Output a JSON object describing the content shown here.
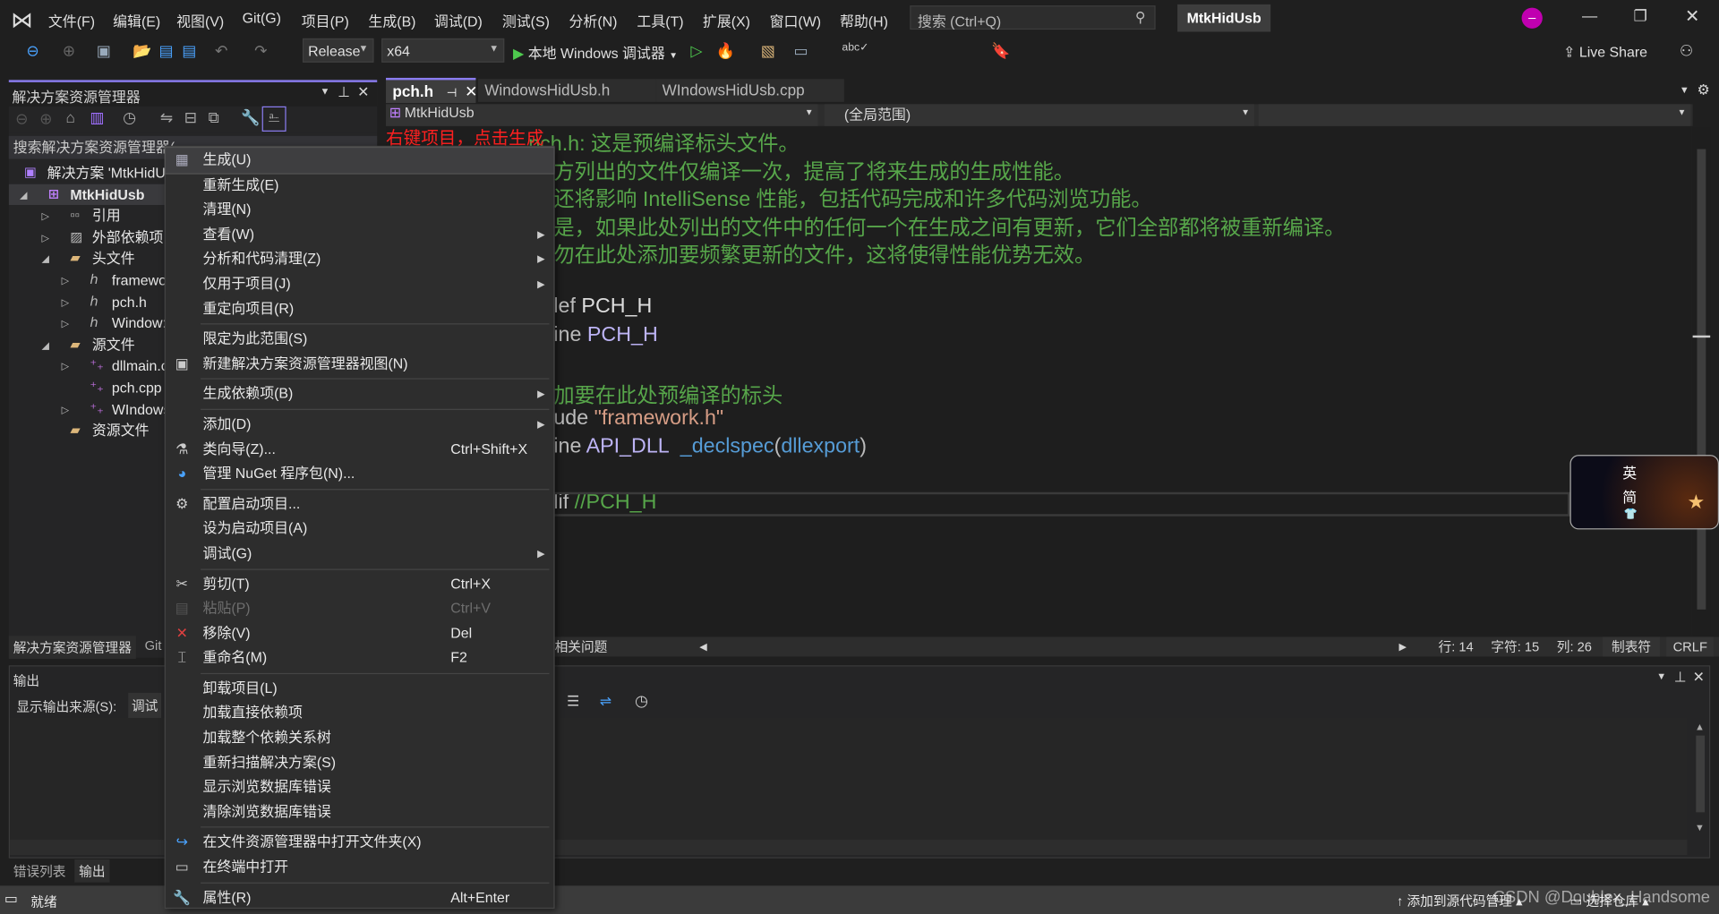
{
  "menu": [
    "文件(F)",
    "编辑(E)",
    "视图(V)",
    "Git(G)",
    "项目(P)",
    "生成(B)",
    "调试(D)",
    "测试(S)",
    "分析(N)",
    "工具(T)",
    "扩展(X)",
    "窗口(W)",
    "帮助(H)"
  ],
  "search_placeholder": "搜索 (Ctrl+Q)",
  "window_title": "MtkHidUsb",
  "toolbar": {
    "configuration": "Release",
    "platform": "x64",
    "debugger": "本地 Windows 调试器",
    "live_share": "Live Share"
  },
  "solution_explorer": {
    "title": "解决方案资源管理器",
    "search_placeholder": "搜索解决方案资源管理器(",
    "tree": [
      {
        "label": "解决方案 'MtkHidU",
        "level": 0,
        "icon": "solution-icon",
        "expander": "none"
      },
      {
        "label": "MtkHidUsb",
        "level": 1,
        "icon": "project-icon",
        "expander": "expanded",
        "selected": true
      },
      {
        "label": "引用",
        "level": 2,
        "icon": "references-icon",
        "expander": "collapsed"
      },
      {
        "label": "外部依赖项",
        "level": 2,
        "icon": "external-deps-icon",
        "expander": "collapsed"
      },
      {
        "label": "头文件",
        "level": 2,
        "icon": "filter-folder-icon",
        "expander": "expanded"
      },
      {
        "label": "framewo",
        "level": 3,
        "icon": "header-file-icon",
        "expander": "collapsed"
      },
      {
        "label": "pch.h",
        "level": 3,
        "icon": "header-file-icon",
        "expander": "collapsed"
      },
      {
        "label": "Window:",
        "level": 3,
        "icon": "header-file-icon",
        "expander": "collapsed"
      },
      {
        "label": "源文件",
        "level": 2,
        "icon": "filter-folder-icon",
        "expander": "expanded"
      },
      {
        "label": "dllmain.c",
        "level": 3,
        "icon": "cpp-file-icon",
        "expander": "collapsed"
      },
      {
        "label": "pch.cpp",
        "level": 3,
        "icon": "cpp-file-icon",
        "expander": "none"
      },
      {
        "label": "WIndows",
        "level": 3,
        "icon": "cpp-file-icon",
        "expander": "collapsed"
      },
      {
        "label": "资源文件",
        "level": 2,
        "icon": "filter-folder-icon",
        "expander": "none"
      }
    ],
    "bottom_tabs": [
      "解决方案资源管理器",
      "Git"
    ]
  },
  "annotation": "右键项目，点击生成",
  "editor": {
    "tabs": [
      {
        "label": "pch.h",
        "active": true
      },
      {
        "label": "WindowsHidUsb.h"
      },
      {
        "label": "WIndowsHidUsb.cpp"
      }
    ],
    "nav_project": "MtkHidUsb",
    "nav_scope": "(全局范围)",
    "lines": [
      {
        "parts": [
          {
            "t": "pch.h: 这是预编译标头文件。",
            "c": "cm"
          }
        ]
      },
      {
        "parts": [
          {
            "t": "方列出的文件仅编译一次，提高了将来生成的生成性能。",
            "c": "cm"
          }
        ]
      },
      {
        "parts": [
          {
            "t": "还将影响 IntelliSense 性能，包括代码完成和许多代码浏览功能。",
            "c": "cm"
          }
        ]
      },
      {
        "parts": [
          {
            "t": "是，如果此处列出的文件中的任何一个在生成之间有更新，它们全部都将被重新编译。",
            "c": "cm"
          }
        ]
      },
      {
        "parts": [
          {
            "t": "勿在此处添加要频繁更新的文件，这将使得性能优势无效。",
            "c": "cm"
          }
        ]
      },
      {
        "parts": []
      },
      {
        "parts": [
          {
            "t": "lef ",
            "c": "kw"
          },
          {
            "t": "PCH_H",
            "c": "kw2"
          }
        ]
      },
      {
        "parts": [
          {
            "t": "ine ",
            "c": "kw"
          },
          {
            "t": "PCH_H",
            "c": "mac"
          }
        ]
      },
      {
        "parts": []
      },
      {
        "parts": [
          {
            "t": "加要在此处预编译的标头",
            "c": "cm"
          }
        ]
      },
      {
        "parts": [
          {
            "t": "ude ",
            "c": "kw"
          },
          {
            "t": "\"framework.h\"",
            "c": "str"
          }
        ]
      },
      {
        "parts": [
          {
            "t": "ine ",
            "c": "kw"
          },
          {
            "t": "API_DLL",
            "c": "mac"
          },
          {
            "t": "  _declspec",
            "c": "fn"
          },
          {
            "t": "(",
            "c": "kw"
          },
          {
            "t": "dllexport",
            "c": "fn"
          },
          {
            "t": ")",
            "c": "kw"
          }
        ]
      },
      {
        "parts": []
      },
      {
        "parts": [
          {
            "t": "lif ",
            "c": "kw"
          },
          {
            "t": "//PCH_H",
            "c": "cm"
          }
        ]
      }
    ],
    "status": {
      "issues": "相关问题",
      "line": "行: 14",
      "char": "字符: 15",
      "col": "列: 26",
      "tabs": "制表符",
      "eol": "CRLF"
    }
  },
  "output": {
    "title": "输出",
    "source_label": "显示输出来源(S):",
    "source_value": "调试",
    "bottom_tabs": [
      "错误列表",
      "输出"
    ]
  },
  "context_menu": [
    {
      "label": "生成(U)",
      "icon": "build-icon",
      "highlighted": true
    },
    {
      "label": "重新生成(E)"
    },
    {
      "label": "清理(N)"
    },
    {
      "label": "查看(W)",
      "submenu": true
    },
    {
      "label": "分析和代码清理(Z)",
      "submenu": true
    },
    {
      "label": "仅用于项目(J)",
      "submenu": true
    },
    {
      "label": "重定向项目(R)"
    },
    {
      "separator": true
    },
    {
      "label": "限定为此范围(S)"
    },
    {
      "label": "新建解决方案资源管理器视图(N)",
      "icon": "new-view-icon"
    },
    {
      "separator": true
    },
    {
      "label": "生成依赖项(B)",
      "submenu": true
    },
    {
      "separator": true
    },
    {
      "label": "添加(D)",
      "submenu": true
    },
    {
      "label": "类向导(Z)...",
      "icon": "class-wizard-icon",
      "shortcut": "Ctrl+Shift+X"
    },
    {
      "label": "管理 NuGet 程序包(N)...",
      "icon": "nuget-icon"
    },
    {
      "separator": true
    },
    {
      "label": "配置启动项目...",
      "icon": "gear-icon"
    },
    {
      "label": "设为启动项目(A)"
    },
    {
      "label": "调试(G)",
      "submenu": true
    },
    {
      "separator": true
    },
    {
      "label": "剪切(T)",
      "icon": "scissors-icon",
      "shortcut": "Ctrl+X"
    },
    {
      "label": "粘贴(P)",
      "icon": "paste-icon",
      "shortcut": "Ctrl+V",
      "disabled": true
    },
    {
      "label": "移除(V)",
      "icon": "remove-icon",
      "shortcut": "Del"
    },
    {
      "label": "重命名(M)",
      "icon": "rename-icon",
      "shortcut": "F2"
    },
    {
      "separator": true
    },
    {
      "label": "卸载项目(L)"
    },
    {
      "label": "加载直接依赖项"
    },
    {
      "label": "加载整个依赖关系树"
    },
    {
      "label": "重新扫描解决方案(S)"
    },
    {
      "label": "显示浏览数据库错误"
    },
    {
      "label": "清除浏览数据库错误"
    },
    {
      "separator": true
    },
    {
      "label": "在文件资源管理器中打开文件夹(X)",
      "icon": "open-folder-icon"
    },
    {
      "label": "在终端中打开",
      "icon": "terminal-icon"
    },
    {
      "separator": true
    },
    {
      "label": "属性(R)",
      "icon": "wrench-icon",
      "shortcut": "Alt+Enter"
    }
  ],
  "ime": {
    "lang": "英",
    "mode": "简"
  },
  "statusbar": {
    "ready": "就绪",
    "add_source_control": "添加到源代码管理",
    "select_repo": "选择仓库",
    "watermark": "CSDN @Doublex_Handsome"
  },
  "colors": {
    "accent": "#8a7cf0",
    "comment": "#57a64a",
    "annotation": "#ff2020",
    "avatar": "#c000b0"
  }
}
